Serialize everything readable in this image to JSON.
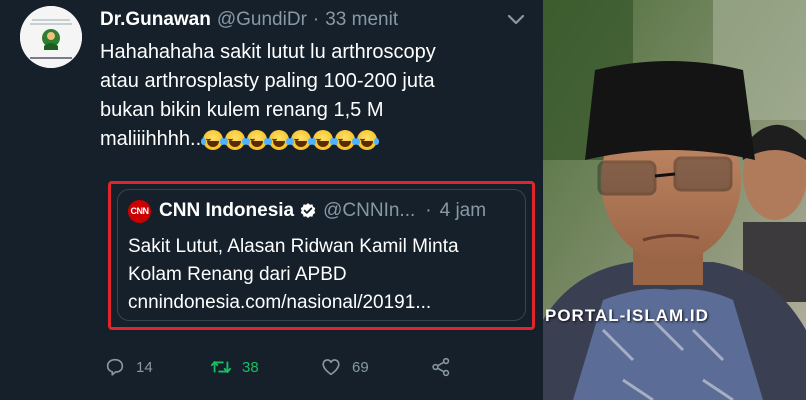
{
  "tweet": {
    "display_name": "Dr.Gunawan",
    "handle": "@GundiDr",
    "separator": "·",
    "time": "33 menit",
    "text_lines": [
      "Hahahahaha sakit lutut lu arthroscopy",
      "atau arthrosplasty paling 100-200 juta",
      "bukan bikin kulem renang 1,5 M",
      "maliiihhhh.."
    ],
    "emoji": "face-with-tears-of-joy",
    "emoji_count": 8,
    "avatar_icon": "profile-avatar"
  },
  "quote": {
    "logo_text": "CNN",
    "name": "CNN Indonesia",
    "verified_icon": "verified-badge-icon",
    "handle": "@CNNIn...",
    "separator": "·",
    "time": "4 jam",
    "text_lines": [
      "Sakit Lutut, Alasan Ridwan Kamil Minta",
      "Kolam Renang dari APBD",
      "cnnindonesia.com/nasional/20191..."
    ],
    "highlight_color": "#e0262a"
  },
  "actions": {
    "reply_count": "14",
    "retweet_count": "38",
    "like_count": "69",
    "retweet_color": "#17bf63"
  },
  "watermark": "PORTAL-ISLAM.ID",
  "colors": {
    "background": "#15202b",
    "text": "#ffffff",
    "muted": "#8899a6",
    "border": "#38444d"
  }
}
